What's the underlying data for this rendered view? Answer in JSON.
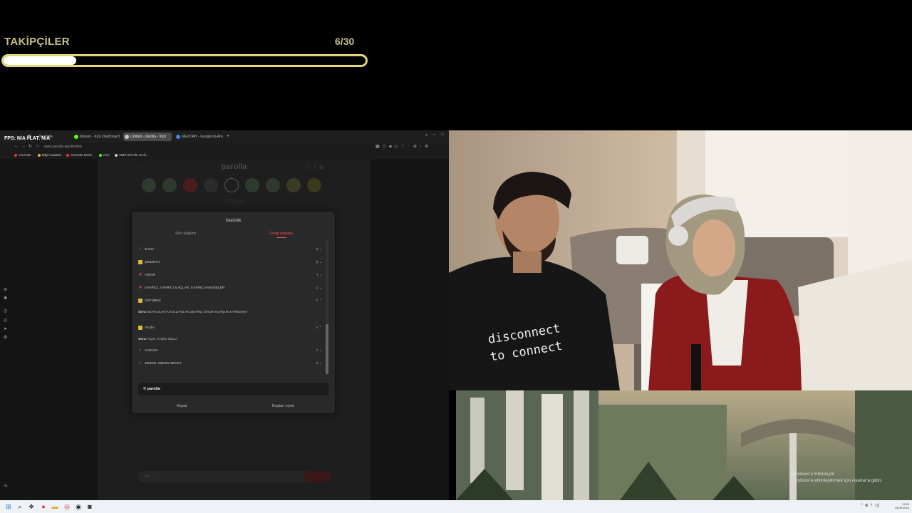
{
  "goal": {
    "title": "TAKİPÇİLER",
    "current": "6",
    "separator": "/",
    "target": "30",
    "progress": 0.2
  },
  "overlay": {
    "fps_label": "FPS: N/A  /  LAT: N/A"
  },
  "browser": {
    "tabs": [
      {
        "label": "...",
        "color": "#888888"
      },
      {
        "label": "...",
        "color": "#cc3333"
      },
      {
        "label": "... - YouTube",
        "color": "#ff3333"
      },
      {
        "label": "Stream - Kick Dashboard",
        "color": "#53fc18"
      },
      {
        "label": "Limitsiz - parolla - Kick",
        "color": "#cccccc",
        "active": true
      },
      {
        "label": "MEDDAH - Google'da Ara",
        "color": "#4285f4"
      }
    ],
    "new_tab": "+",
    "url": "www.parolla.app/limitsiz",
    "bookmarks": [
      {
        "label": "YouTube",
        "color": "#ff3333"
      },
      {
        "label": "Bilgi Anadamı",
        "color": "#e0b73a"
      },
      {
        "label": "YouTube Music",
        "color": "#ff3333"
      },
      {
        "label": "Kick",
        "color": "#53fc18"
      },
      {
        "label": "ABDİ BÜYÜK BAĞ...",
        "color": "#cccccc"
      }
    ]
  },
  "page": {
    "title": "parolla",
    "timer": "17:00 M",
    "circle_colors": [
      "#2f3a2f",
      "#2f3a2f",
      "#4a1c1c",
      "#2b2b2b",
      "#1e1e1e",
      "#2f3a2f",
      "#2f3a2f",
      "#3a3a25",
      "#3a3a18"
    ],
    "input_placeholder": "Yaz..."
  },
  "modal": {
    "title": "İstatistik",
    "tabs": {
      "score": "Skor bağlantı",
      "answers": "Cevap anahtarı"
    },
    "rows": [
      {
        "word": "SANA",
        "status": "correct",
        "letter": "S"
      },
      {
        "word": "ŞİDDETLİ",
        "status": "pass",
        "letter": "Ş"
      },
      {
        "word": "TIMAR",
        "status": "wrong",
        "letter": "T"
      },
      {
        "word": "UYARICI, UYARICI İLAÇLAR, UYARICI HADİSELER",
        "status": "wrong",
        "letter": "U"
      },
      {
        "word": "ÜSTÜBEÇ",
        "status": "pass",
        "letter": "Ü"
      },
      {
        "word": "VAZİH",
        "status": "pass",
        "letter": "V"
      },
      {
        "word": "YAKUZA",
        "status": "correct",
        "letter": "Y"
      },
      {
        "word": "ZIDDIN, ZIDDIN SEHPA",
        "status": "correct",
        "letter": "Z"
      }
    ],
    "questions": [
      {
        "label": "Soru:",
        "text": "BOYACILIKTA KULLANILAN ZEHİRLİ, BAZİK KURŞUN KARBONAT"
      },
      {
        "label": "Soru:",
        "text": "AÇIK, AYDIN, BELLİ"
      }
    ],
    "brand": "parolla",
    "close_label": "Kapat",
    "restart_label": "Baştan oyna"
  },
  "webcam": {
    "shirt_text_1": "disconnect",
    "shirt_text_2": "to connect"
  },
  "desktop": {
    "activation_title": "Windows'u Etkinleştir",
    "activation_sub": "Windows'u etkinleştirmek için Ayarlar'a gidin."
  },
  "taskbar": {
    "clock_time": "13:28",
    "clock_date": "25.08.2024",
    "tray_icons": "⌃ ⊕ ⇡ ◁)"
  }
}
